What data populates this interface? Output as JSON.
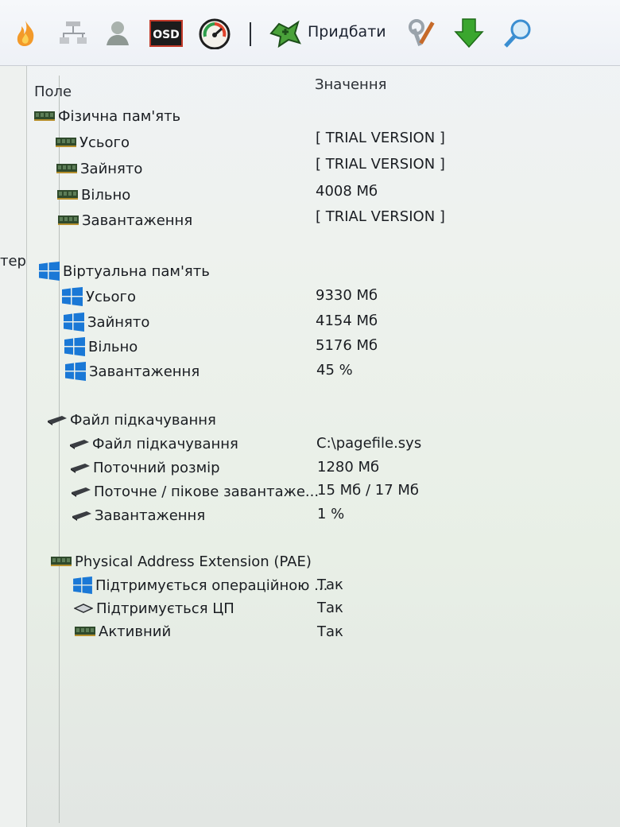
{
  "toolbar": {
    "icons": [
      "flame-icon",
      "network-icon",
      "user-icon",
      "osd-icon",
      "gauge-icon",
      "add-icon",
      "tools-icon",
      "download-icon",
      "search-icon"
    ],
    "osd_text": "OSD",
    "add_label": "Придбати"
  },
  "sidebar": {
    "partial_label": "тер"
  },
  "columns": {
    "field": "Поле",
    "value": "Значення"
  },
  "sections": {
    "physical": {
      "title": "Фізична пам'ять",
      "rows": [
        {
          "label": "Усього",
          "value": "[ TRIAL VERSION ]"
        },
        {
          "label": "Зайнято",
          "value": "[ TRIAL VERSION ]"
        },
        {
          "label": "Вільно",
          "value": "4008 Мб"
        },
        {
          "label": "Завантаження",
          "value": "[ TRIAL VERSION ]"
        }
      ]
    },
    "virtual": {
      "title": "Віртуальна пам'ять",
      "rows": [
        {
          "label": "Усього",
          "value": "9330 Мб"
        },
        {
          "label": "Зайнято",
          "value": "4154 Мб"
        },
        {
          "label": "Вільно",
          "value": "5176 Мб"
        },
        {
          "label": "Завантаження",
          "value": "45 %"
        }
      ]
    },
    "pagefile": {
      "title": "Файл підкачування",
      "rows": [
        {
          "label": "Файл підкачування",
          "value": "C:\\pagefile.sys"
        },
        {
          "label": "Поточний розмір",
          "value": "1280 Мб"
        },
        {
          "label": "Поточне / пікове завантаже...",
          "value": "15 Мб / 17 Мб"
        },
        {
          "label": "Завантаження",
          "value": "1 %"
        }
      ]
    },
    "pae": {
      "title": "Physical Address Extension (PAE)",
      "rows": [
        {
          "label": "Підтримується операційною ...",
          "value": "Так"
        },
        {
          "label": "Підтримується ЦП",
          "value": "Так"
        },
        {
          "label": "Активний",
          "value": "Так"
        }
      ]
    }
  },
  "colors": {
    "ram_green": "#2f4a2c",
    "windows_blue": "#1a78d6",
    "drive_gray": "#3a3d42",
    "download_green": "#3aa62e"
  }
}
